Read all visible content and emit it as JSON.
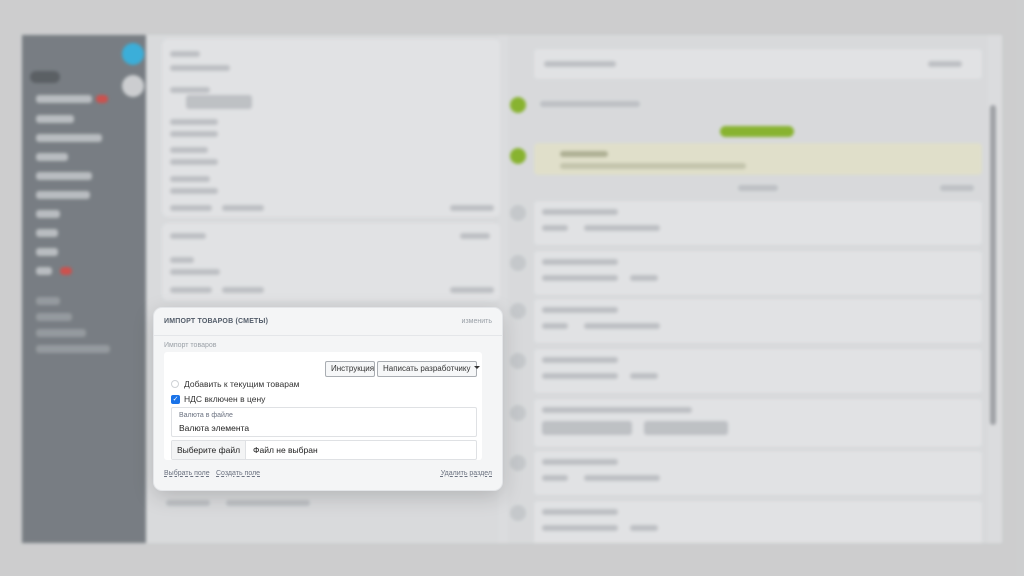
{
  "card": {
    "title": "ИМПОРТ ТОВАРОВ (СМЕТЫ)",
    "edit_label": "изменить",
    "section_label": "Импорт товаров",
    "instruction_button": "Инструкция",
    "developer_button": "Написать разработчику",
    "option_add": "Добавить к текущим товарам",
    "option_vat": "НДС включен в цену",
    "option_vat_checked": true,
    "currency_field": {
      "label": "Валюта в файле",
      "value": "Валюта элемента"
    },
    "file_input": {
      "button": "Выберите файл",
      "status": "Файл не выбран"
    },
    "footer": {
      "select_field": "Выбрать поле",
      "create_field": "Создать поле",
      "delete_section": "Удалить раздел"
    }
  },
  "colors": {
    "accent": "#1a73e8",
    "activity_green": "#8fbd2f",
    "close_button": "#3bb8e6"
  }
}
